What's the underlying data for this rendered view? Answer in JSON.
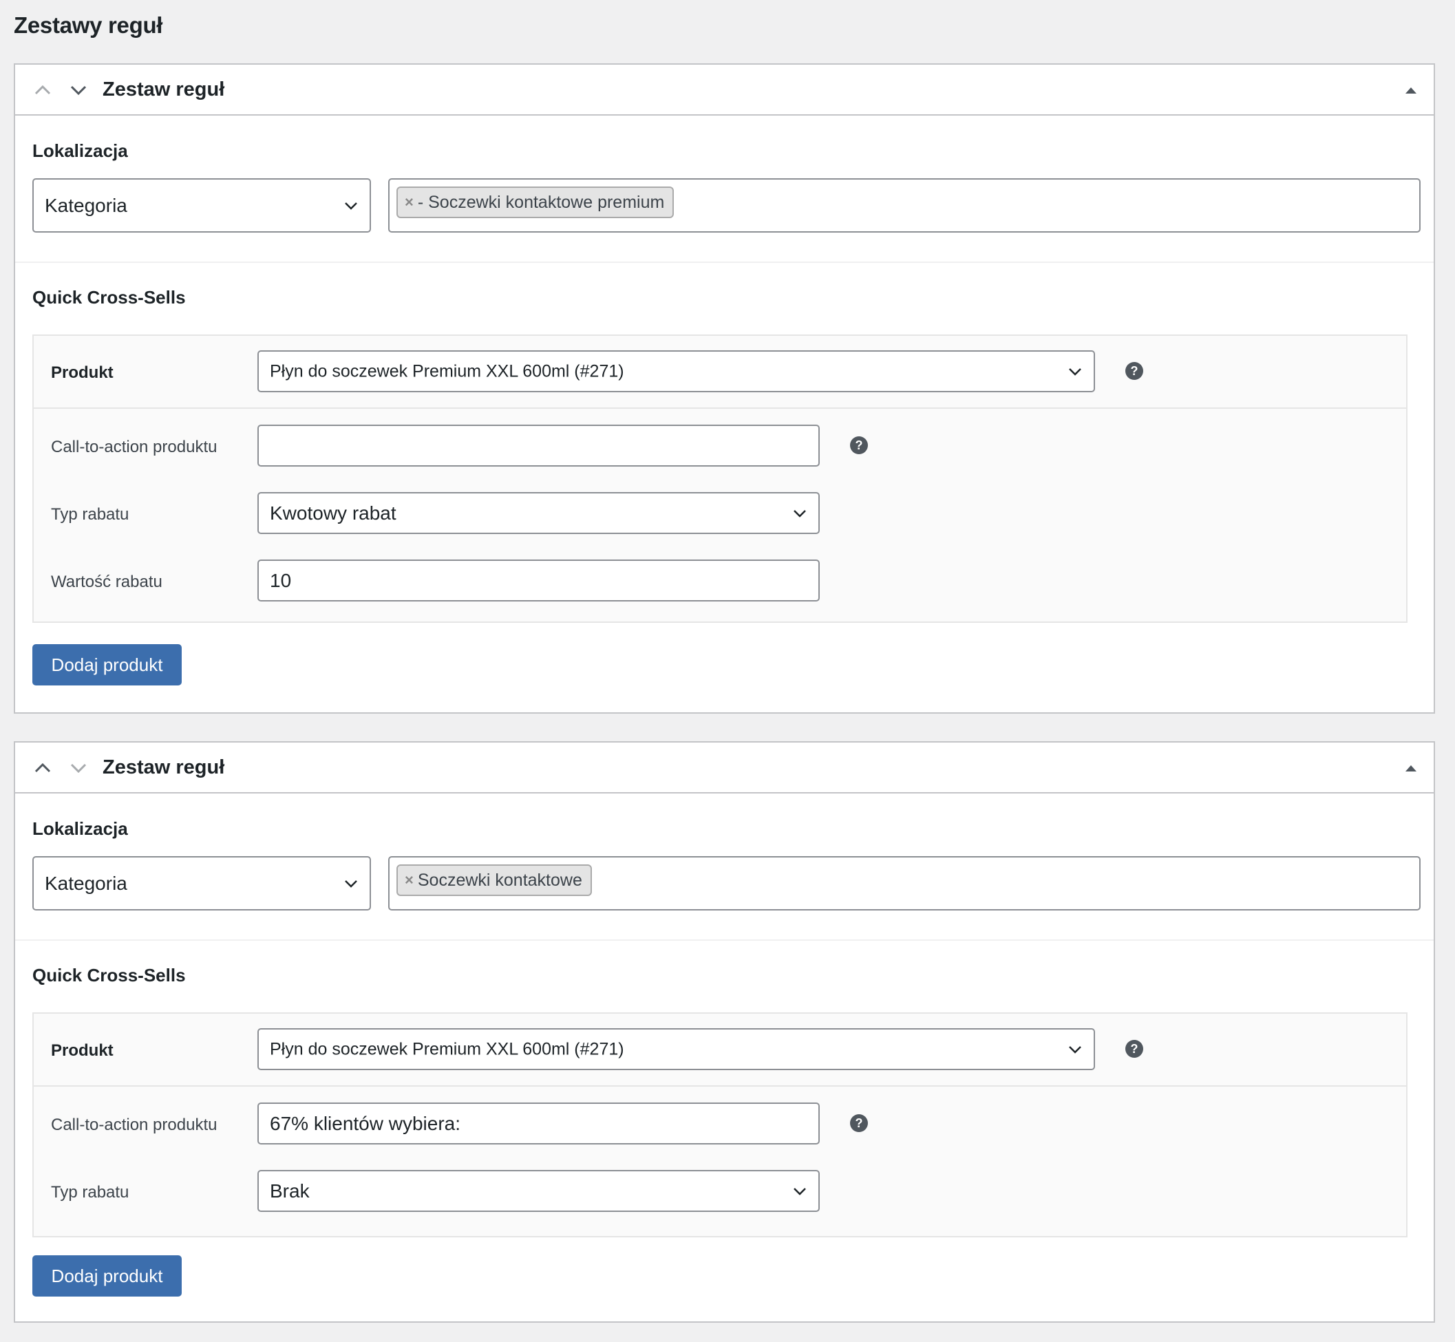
{
  "page": {
    "title": "Zestawy reguł"
  },
  "rule_sets": [
    {
      "header": {
        "title": "Zestaw reguł"
      },
      "location": {
        "label": "Lokalizacja",
        "type_value": "Kategoria",
        "tags": [
          "- Soczewki kontaktowe premium"
        ]
      },
      "cross_sells": {
        "label": "Quick Cross-Sells",
        "product_label": "Produkt",
        "product_value": "Płyn do soczewek Premium XXL 600ml (#271)",
        "cta_label": "Call-to-action produktu",
        "cta_value": "",
        "discount_type_label": "Typ rabatu",
        "discount_type_value": "Kwotowy rabat",
        "discount_value_label": "Wartość rabatu",
        "discount_value": "10",
        "add_button": "Dodaj produkt"
      }
    },
    {
      "header": {
        "title": "Zestaw reguł"
      },
      "location": {
        "label": "Lokalizacja",
        "type_value": "Kategoria",
        "tags": [
          "Soczewki kontaktowe"
        ]
      },
      "cross_sells": {
        "label": "Quick Cross-Sells",
        "product_label": "Produkt",
        "product_value": "Płyn do soczewek Premium XXL 600ml (#271)",
        "cta_label": "Call-to-action produktu",
        "cta_value": "67% klientów wybiera:",
        "discount_type_label": "Typ rabatu",
        "discount_type_value": "Brak",
        "add_button": "Dodaj produkt"
      }
    }
  ],
  "icons": {
    "help": "?",
    "tag_remove": "×"
  },
  "colors": {
    "primary_button": "#3c6ead",
    "background": "#f0f0f1",
    "border": "#c3c4c7"
  }
}
